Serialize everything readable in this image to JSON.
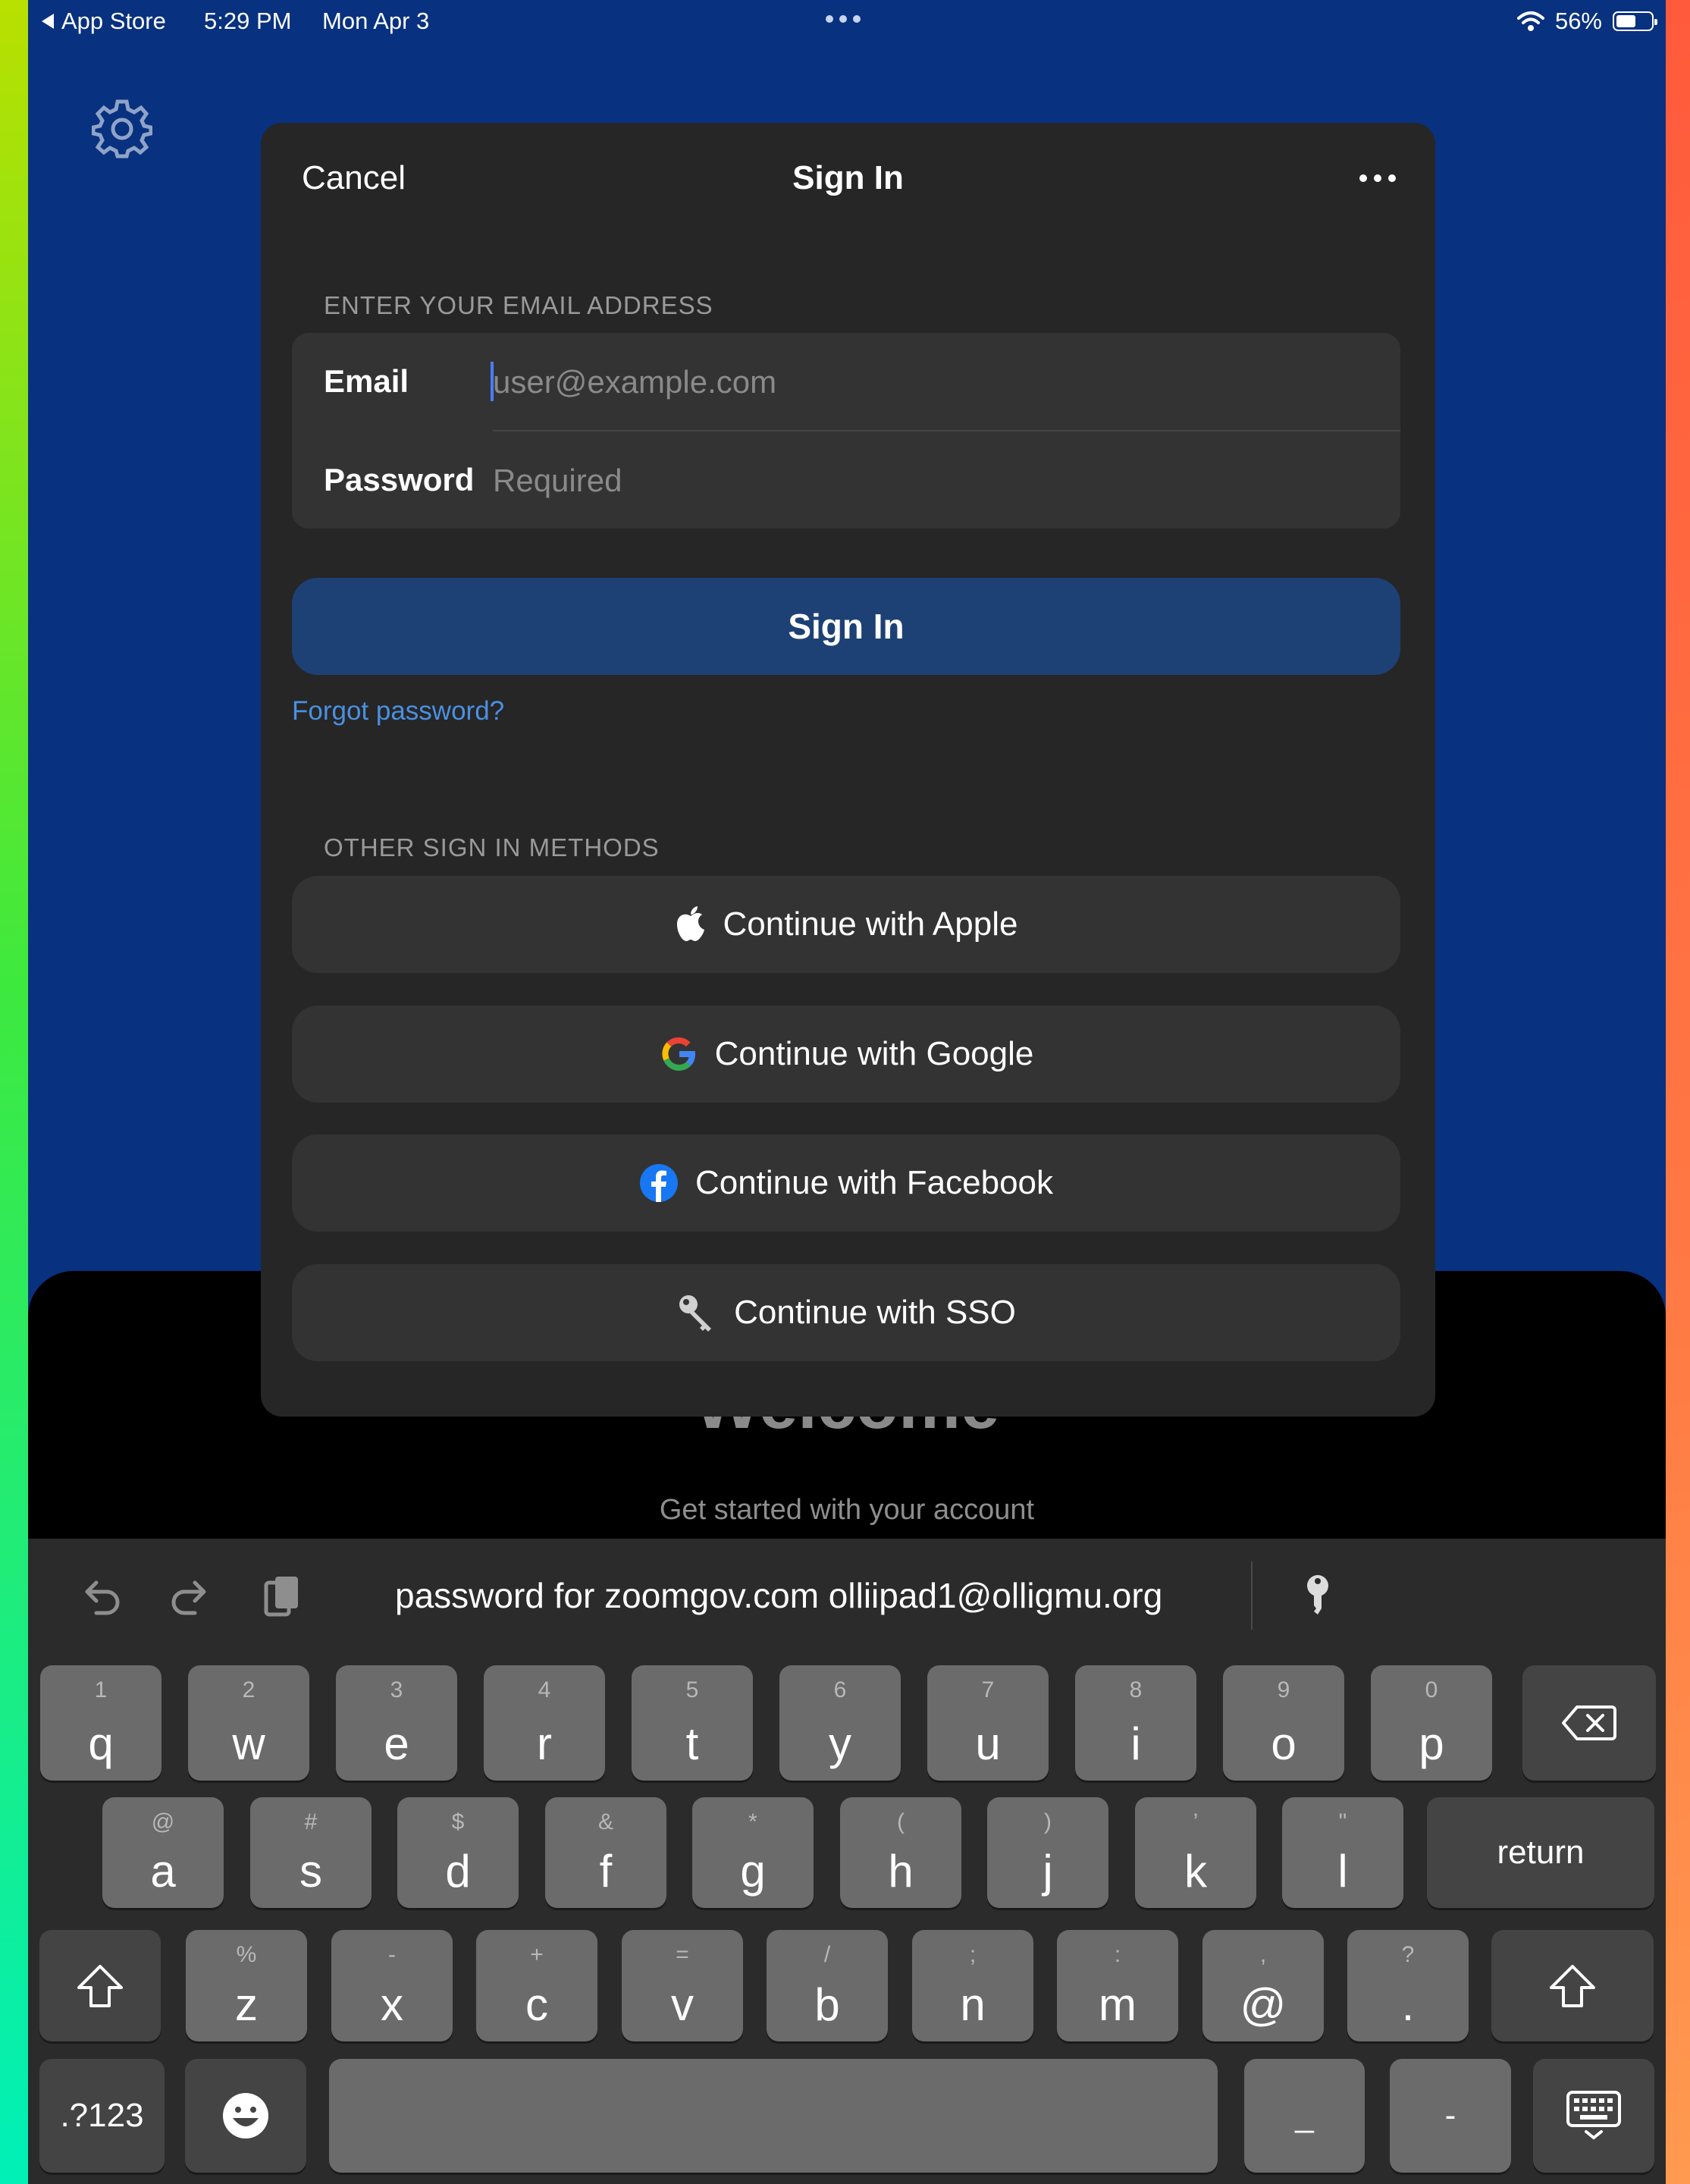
{
  "status_bar": {
    "back_label": "App Store",
    "time": "5:29 PM",
    "date": "Mon Apr 3",
    "battery_text": "56%",
    "battery_level": 0.56
  },
  "background": {
    "welcome_title": "Welcome",
    "welcome_subtitle": "Get started with your account"
  },
  "modal": {
    "cancel_label": "Cancel",
    "title": "Sign In",
    "email_section_label": "ENTER YOUR EMAIL ADDRESS",
    "email_label": "Email",
    "email_placeholder": "user@example.com",
    "password_label": "Password",
    "password_placeholder": "Required",
    "signin_button": "Sign In",
    "forgot_password": "Forgot password?",
    "other_methods_label": "OTHER SIGN IN METHODS",
    "methods": [
      {
        "label": "Continue with Apple",
        "icon": "apple-icon"
      },
      {
        "label": "Continue with Google",
        "icon": "google-icon"
      },
      {
        "label": "Continue with Facebook",
        "icon": "facebook-icon"
      },
      {
        "label": "Continue with SSO",
        "icon": "key-icon"
      }
    ]
  },
  "keyboard": {
    "suggestion": "password for zoomgov.com  olliipad1@olligmu.org",
    "row1": [
      {
        "main": "q",
        "hint": "1"
      },
      {
        "main": "w",
        "hint": "2"
      },
      {
        "main": "e",
        "hint": "3"
      },
      {
        "main": "r",
        "hint": "4"
      },
      {
        "main": "t",
        "hint": "5"
      },
      {
        "main": "y",
        "hint": "6"
      },
      {
        "main": "u",
        "hint": "7"
      },
      {
        "main": "i",
        "hint": "8"
      },
      {
        "main": "o",
        "hint": "9"
      },
      {
        "main": "p",
        "hint": "0"
      }
    ],
    "row2": [
      {
        "main": "a",
        "hint": "@"
      },
      {
        "main": "s",
        "hint": "#"
      },
      {
        "main": "d",
        "hint": "$"
      },
      {
        "main": "f",
        "hint": "&"
      },
      {
        "main": "g",
        "hint": "*"
      },
      {
        "main": "h",
        "hint": "("
      },
      {
        "main": "j",
        "hint": ")"
      },
      {
        "main": "k",
        "hint": "’"
      },
      {
        "main": "l",
        "hint": "\""
      }
    ],
    "row3": [
      {
        "main": "z",
        "hint": "%"
      },
      {
        "main": "x",
        "hint": "-"
      },
      {
        "main": "c",
        "hint": "+"
      },
      {
        "main": "v",
        "hint": "="
      },
      {
        "main": "b",
        "hint": "/"
      },
      {
        "main": "n",
        "hint": ";"
      },
      {
        "main": "m",
        "hint": ":"
      },
      {
        "main": "@",
        "hint": ","
      },
      {
        "main": ".",
        "hint": "?"
      }
    ],
    "return_label": "return",
    "numbers_label": ".?123",
    "underscore_label": "_",
    "dash_label": "-"
  },
  "colors": {
    "background_blue": "#08317f",
    "modal": "#262626",
    "field": "#333333",
    "signin_button": "#1d4174",
    "link": "#4a90e2",
    "keyboard": "#2b2b2b",
    "key": "#6b6b6b",
    "key_dark": "#444444"
  }
}
